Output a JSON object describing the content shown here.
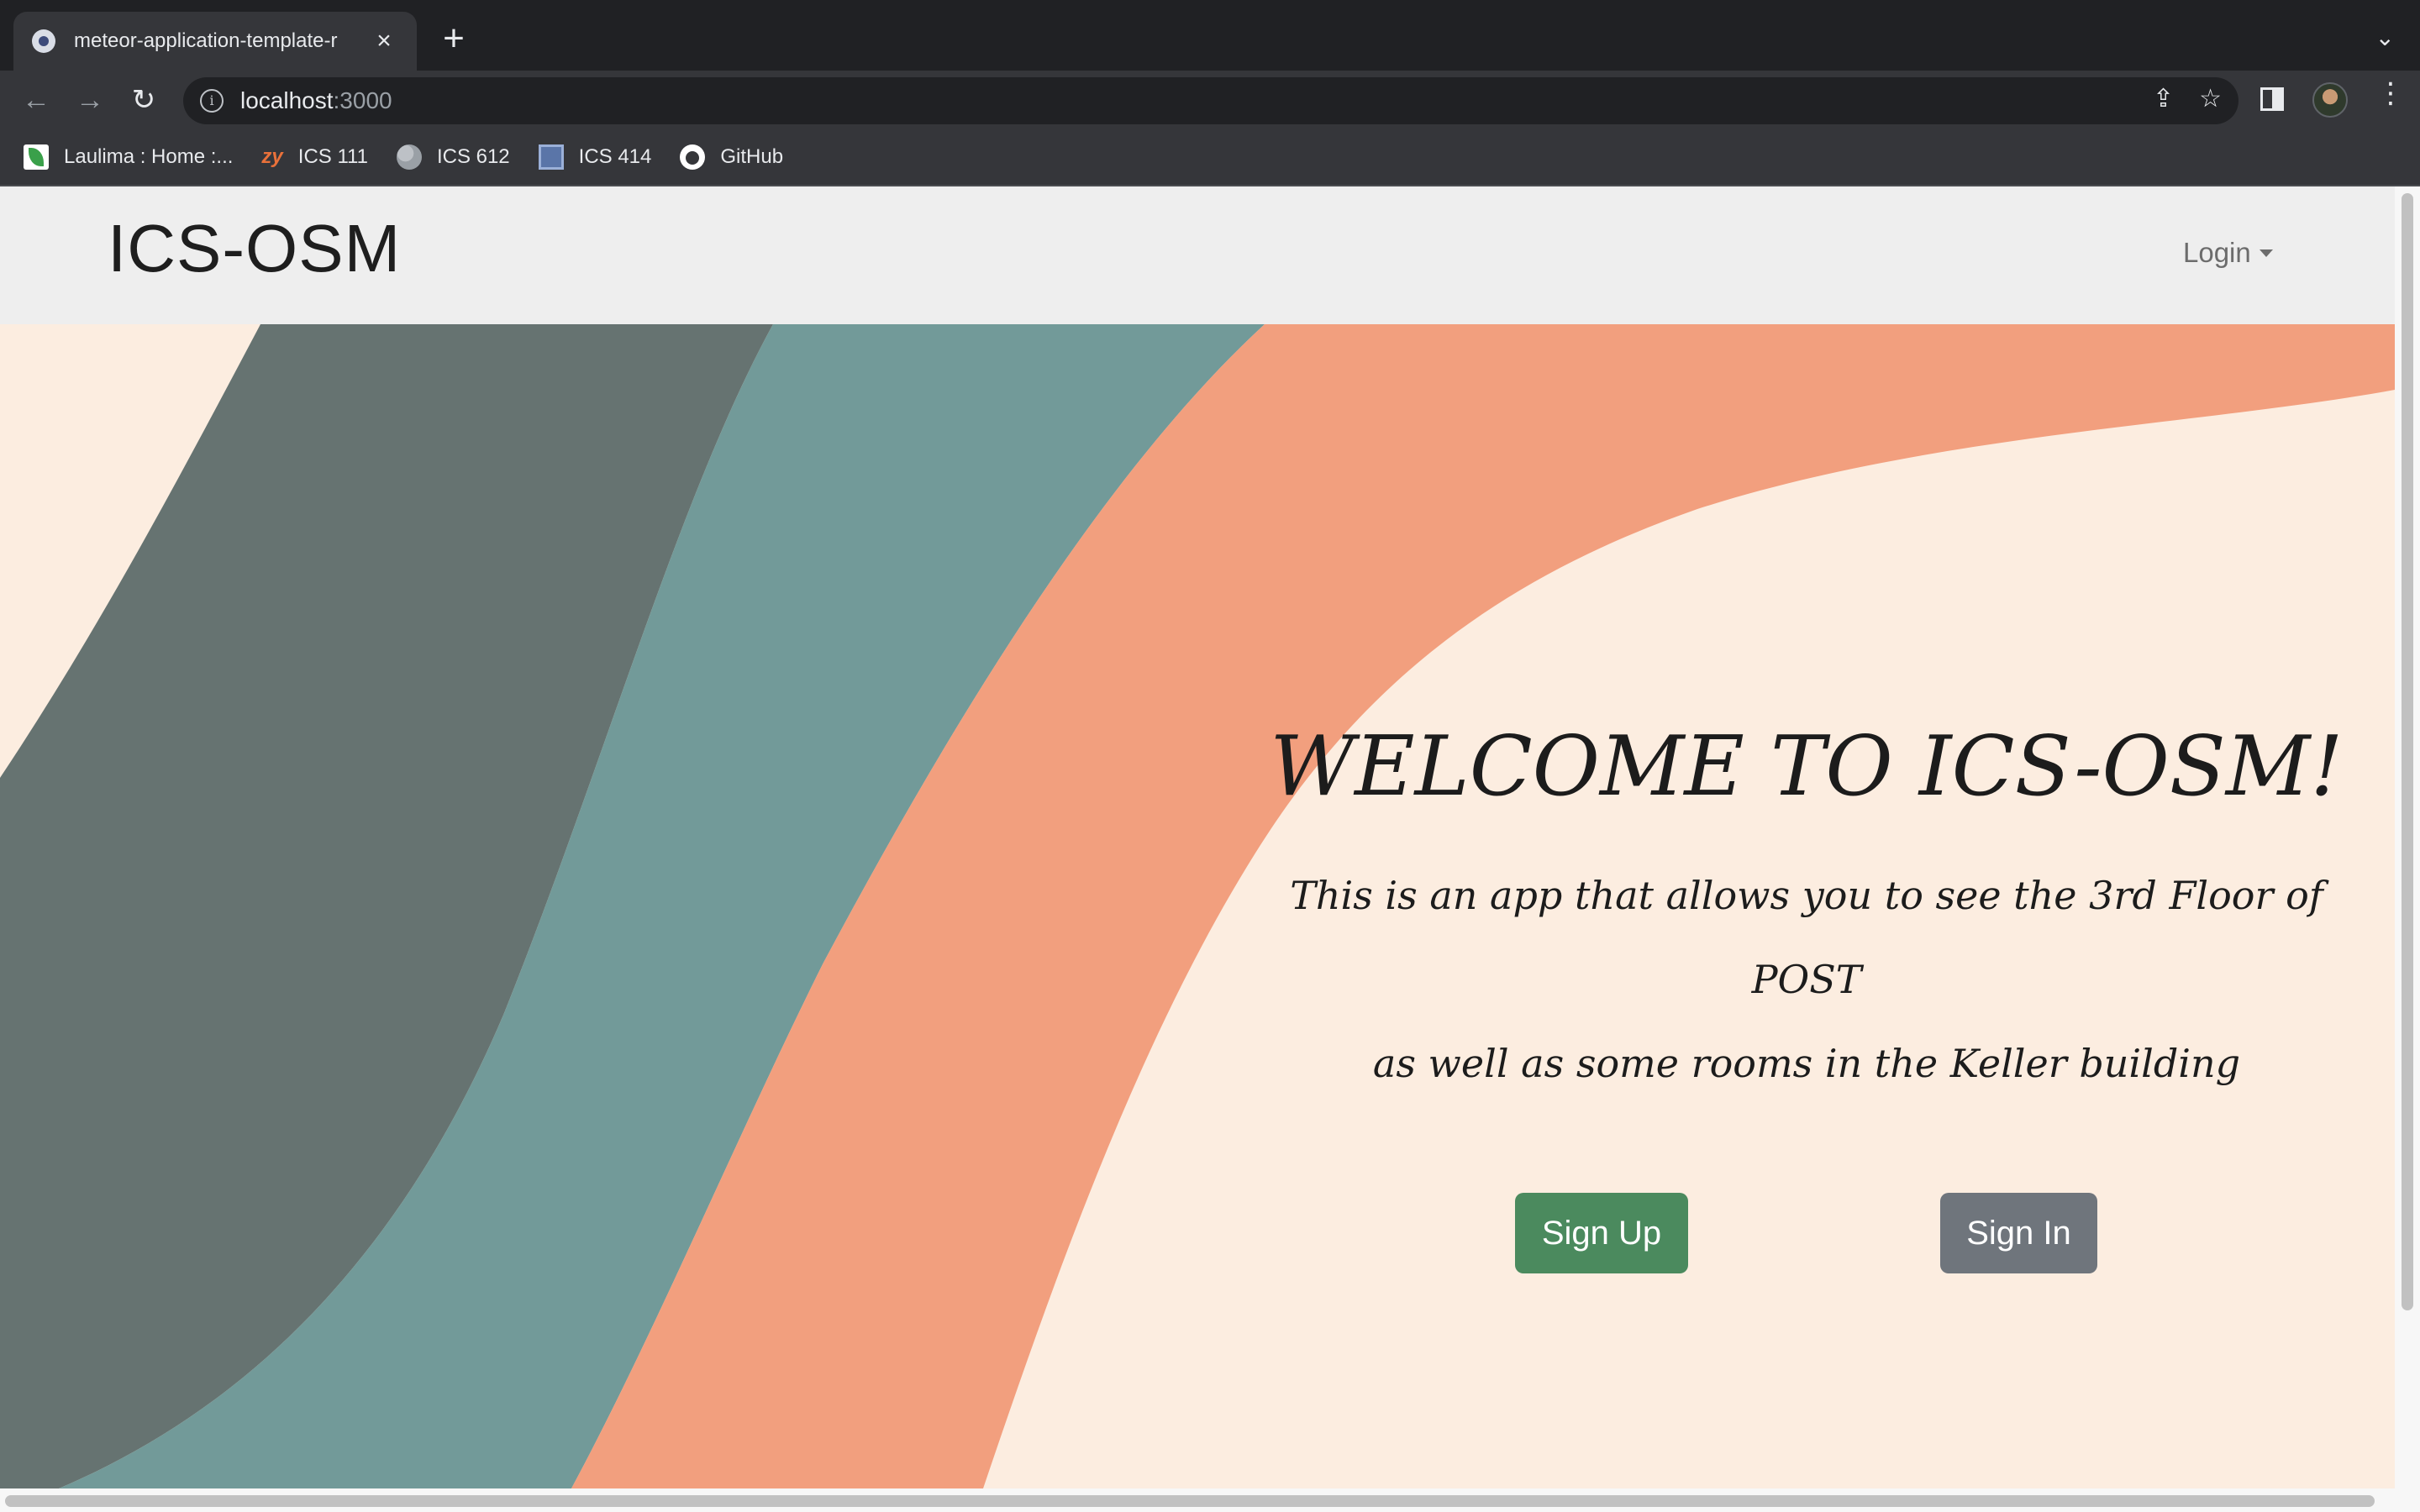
{
  "browser": {
    "tab_title": "meteor-application-template-r",
    "tab_close_icon": "close-icon",
    "new_tab_symbol": "+",
    "tab_search_symbol": "⌄",
    "url_host": "localhost",
    "url_port": ":3000",
    "bookmarks": [
      {
        "label": "Laulima : Home :...",
        "icon": "laulima-icon"
      },
      {
        "label": "ICS 111",
        "icon": "zybooks-icon"
      },
      {
        "label": "ICS 612",
        "icon": "globe-icon"
      },
      {
        "label": "ICS 414",
        "icon": "square-icon"
      },
      {
        "label": "GitHub",
        "icon": "github-icon"
      }
    ],
    "zy_text": "zy"
  },
  "site": {
    "brand": "ICS-OSM",
    "login_label": "Login"
  },
  "hero": {
    "title": "WELCOME TO ICS-OSM!",
    "subtitle_line1": "This is an app that allows you to see the 3rd Floor of POST",
    "subtitle_line2": "as well as some rooms in the Keller building",
    "signup_label": "Sign Up",
    "signin_label": "Sign In"
  },
  "colors": {
    "background_cream": "#fcede0",
    "wave_dark": "#667371",
    "wave_teal": "#729a99",
    "wave_salmon": "#f29f7e",
    "signup_green": "#4b8a5e",
    "signin_gray": "#6f757c"
  }
}
